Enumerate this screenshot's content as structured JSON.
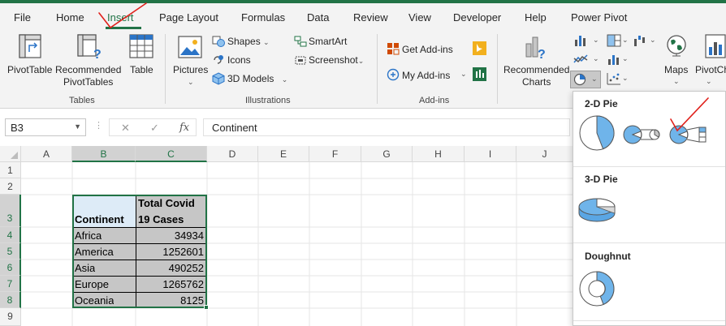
{
  "menu": {
    "tabs": [
      {
        "label": "File"
      },
      {
        "label": "Home"
      },
      {
        "label": "Insert",
        "active": true
      },
      {
        "label": "Page Layout"
      },
      {
        "label": "Formulas"
      },
      {
        "label": "Data"
      },
      {
        "label": "Review"
      },
      {
        "label": "View"
      },
      {
        "label": "Developer"
      },
      {
        "label": "Help"
      },
      {
        "label": "Power Pivot"
      }
    ]
  },
  "ribbon": {
    "tables": {
      "pivottable": "PivotTable",
      "recommended_line1": "Recommended",
      "recommended_line2": "PivotTables",
      "table": "Table",
      "group": "Tables"
    },
    "illustrations": {
      "pictures": "Pictures",
      "shapes": "Shapes",
      "icons": "Icons",
      "models": "3D Models",
      "smartart": "SmartArt",
      "screenshot": "Screenshot",
      "group": "Illustrations"
    },
    "addins": {
      "get": "Get Add-ins",
      "my": "My Add-ins",
      "group": "Add-ins"
    },
    "charts": {
      "recommended_line1": "Recommended",
      "recommended_line2": "Charts",
      "maps": "Maps",
      "pivotchart": "PivotCh"
    }
  },
  "formula_bar": {
    "name_box": "B3",
    "fx": "fx",
    "content": "Continent"
  },
  "sheet": {
    "columns": [
      "A",
      "B",
      "C",
      "D",
      "E",
      "F",
      "G",
      "H",
      "I",
      "J"
    ],
    "rows": [
      "1",
      "2",
      "3",
      "4",
      "5",
      "6",
      "7",
      "8",
      "9"
    ],
    "header": {
      "continent": "Continent",
      "cases_line1": "Total Covid",
      "cases_line2": "19 Cases"
    },
    "data": [
      {
        "continent": "Africa",
        "cases": "34934"
      },
      {
        "continent": "America",
        "cases": "1252601"
      },
      {
        "continent": "Asia",
        "cases": "490252"
      },
      {
        "continent": "Europe",
        "cases": "1265762"
      },
      {
        "continent": "Oceania",
        "cases": "8125"
      }
    ]
  },
  "pie_dropdown": {
    "section_2d": "2-D Pie",
    "section_3d": "3-D Pie",
    "section_doughnut": "Doughnut"
  },
  "colors": {
    "accent": "#217346",
    "pie_fill": "#6fb4ea",
    "selection_fill": "#c6c6c6",
    "annotation": "#e0201b"
  }
}
